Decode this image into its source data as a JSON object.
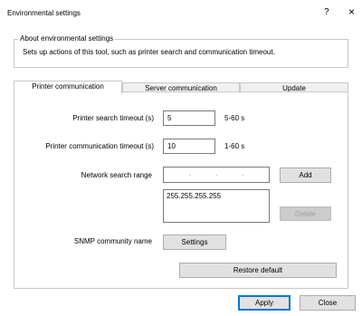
{
  "window": {
    "title": "Environmental settings",
    "help_glyph": "?",
    "close_glyph": "×"
  },
  "about": {
    "legend": "About environmental settings",
    "description": "Sets up actions of this tool, such as printer search and communication timeout."
  },
  "tabs": [
    {
      "label": "Printer communication",
      "active": true
    },
    {
      "label": "Server communication",
      "active": false
    },
    {
      "label": "Update",
      "active": false
    }
  ],
  "fields": {
    "search_timeout": {
      "label": "Printer search timeout (s)",
      "value": "5",
      "range": "5-60 s"
    },
    "comm_timeout": {
      "label": "Printer communication timeout (s)",
      "value": "10",
      "range": "1-60 s"
    },
    "network_range": {
      "label": "Network search range",
      "ip_dots": ".",
      "list": [
        "255.255.255.255"
      ]
    },
    "snmp": {
      "label": "SNMP community name"
    }
  },
  "buttons": {
    "add": "Add",
    "delete": "Delete",
    "settings": "Settings",
    "restore": "Restore default",
    "apply": "Apply",
    "close": "Close"
  }
}
